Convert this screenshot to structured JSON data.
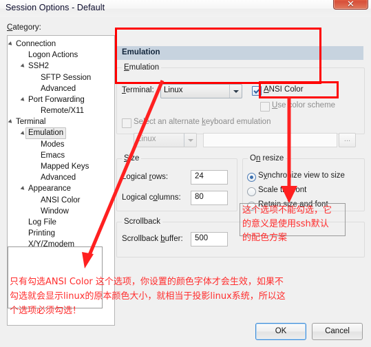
{
  "window": {
    "title": "Session Options - Default",
    "close_icon": "close-icon",
    "close_glyph": "✕"
  },
  "sidebar": {
    "label": "Category:",
    "label_mnemonic": "C",
    "items": [
      {
        "label": "Connection",
        "indent": 0,
        "twisty": true,
        "selected": false
      },
      {
        "label": "Logon Actions",
        "indent": 1,
        "twisty": false,
        "selected": false
      },
      {
        "label": "SSH2",
        "indent": 1,
        "twisty": true,
        "selected": false
      },
      {
        "label": "SFTP Session",
        "indent": 2,
        "twisty": false,
        "selected": false
      },
      {
        "label": "Advanced",
        "indent": 2,
        "twisty": false,
        "selected": false
      },
      {
        "label": "Port Forwarding",
        "indent": 1,
        "twisty": true,
        "selected": false
      },
      {
        "label": "Remote/X11",
        "indent": 2,
        "twisty": false,
        "selected": false
      },
      {
        "label": "Terminal",
        "indent": 0,
        "twisty": true,
        "selected": false
      },
      {
        "label": "Emulation",
        "indent": 1,
        "twisty": true,
        "selected": true
      },
      {
        "label": "Modes",
        "indent": 2,
        "twisty": false,
        "selected": false
      },
      {
        "label": "Emacs",
        "indent": 2,
        "twisty": false,
        "selected": false
      },
      {
        "label": "Mapped Keys",
        "indent": 2,
        "twisty": false,
        "selected": false
      },
      {
        "label": "Advanced",
        "indent": 2,
        "twisty": false,
        "selected": false
      },
      {
        "label": "Appearance",
        "indent": 1,
        "twisty": true,
        "selected": false
      },
      {
        "label": "ANSI Color",
        "indent": 2,
        "twisty": false,
        "selected": false
      },
      {
        "label": "Window",
        "indent": 2,
        "twisty": false,
        "selected": false
      },
      {
        "label": "Log File",
        "indent": 1,
        "twisty": false,
        "selected": false
      },
      {
        "label": "Printing",
        "indent": 1,
        "twisty": false,
        "selected": false
      },
      {
        "label": "X/Y/Zmodem",
        "indent": 1,
        "twisty": false,
        "selected": false
      }
    ]
  },
  "pane": {
    "header": "Emulation",
    "emulation_group": {
      "title": "Emulation",
      "title_mnemonic": "E",
      "terminal_label": "Terminal:",
      "terminal_mnemonic": "T",
      "terminal_value": "Linux",
      "ansi_color_label": "ANSI Color",
      "ansi_color_mnemonic": "A",
      "ansi_color_checked": true,
      "use_color_scheme_label": "Use color scheme",
      "use_color_scheme_mnemonic": "U",
      "use_color_scheme_checked": false,
      "alt_keyboard_label": "Select an alternate keyboard emulation",
      "alt_keyboard_mnemonic": "k",
      "alt_keyboard_checked": false,
      "alt_keyboard_combo_value": "Linux",
      "alt_keyboard_text_value": "",
      "browse_label": "..."
    },
    "size_group": {
      "title": "Size",
      "title_mnemonic": "S",
      "rows_label": "Logical rows:",
      "rows_mnemonic": "r",
      "rows_value": "24",
      "cols_label": "Logical columns:",
      "cols_mnemonic": "o",
      "cols_value": "80"
    },
    "on_resize_group": {
      "title": "On resize",
      "title_mnemonic": "n",
      "options": [
        {
          "label": "Synchronize view to size",
          "mnemonic": "y",
          "selected": true
        },
        {
          "label": "Scale the font",
          "mnemonic": "",
          "selected": false
        },
        {
          "label": "Retain size and font",
          "mnemonic": "",
          "selected": false
        }
      ]
    },
    "scrollback_group": {
      "title": "Scrollback",
      "buffer_label": "Scrollback buffer:",
      "buffer_mnemonic": "b",
      "buffer_value": "500"
    }
  },
  "footer": {
    "ok_label": "OK",
    "cancel_label": "Cancel"
  },
  "annotations": {
    "accent_color": "#ff0000",
    "text_color": "#ff2d2d",
    "right_note": {
      "lines": [
        "这个选项不能勾选，它",
        "的意义是使用ssh默认",
        "的配色方案"
      ]
    },
    "bottom_note": {
      "lines": [
        "只有勾选ANSI Color 这个选项，你设置的颜色字体才会生效，如果不",
        "勾选就会显示linux的原本颜色大小，就相当于投影linux系统，所以这",
        "个选项必须勾选！"
      ]
    }
  }
}
